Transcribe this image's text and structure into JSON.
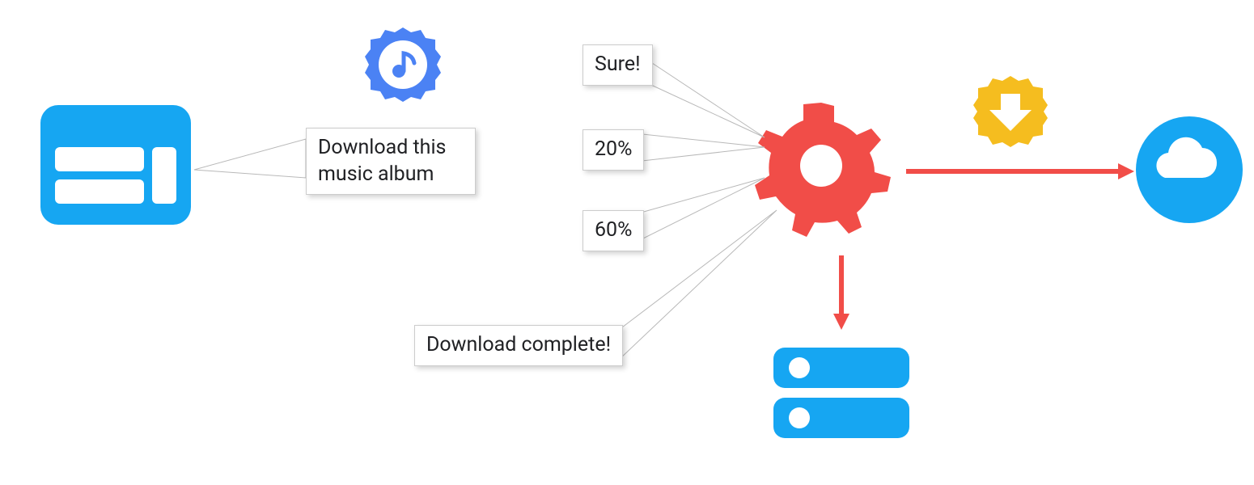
{
  "colors": {
    "blue": "#16A6F2",
    "badge_blue": "#4B82F4",
    "red": "#F14D48",
    "yellow": "#F5BD1F",
    "grey": "#B8B8B8"
  },
  "icons": {
    "app_window": "app-window-icon",
    "music_badge": "music-note-seal-icon",
    "gear": "gear-icon",
    "download_badge": "download-arrow-seal-icon",
    "cloud": "cloud-icon",
    "storage": "storage-drives-icon"
  },
  "bubbles": {
    "request": "Download this\nmusic album",
    "ack": "Sure!",
    "progress1": "20%",
    "progress2": "60%",
    "complete": "Download complete!"
  }
}
